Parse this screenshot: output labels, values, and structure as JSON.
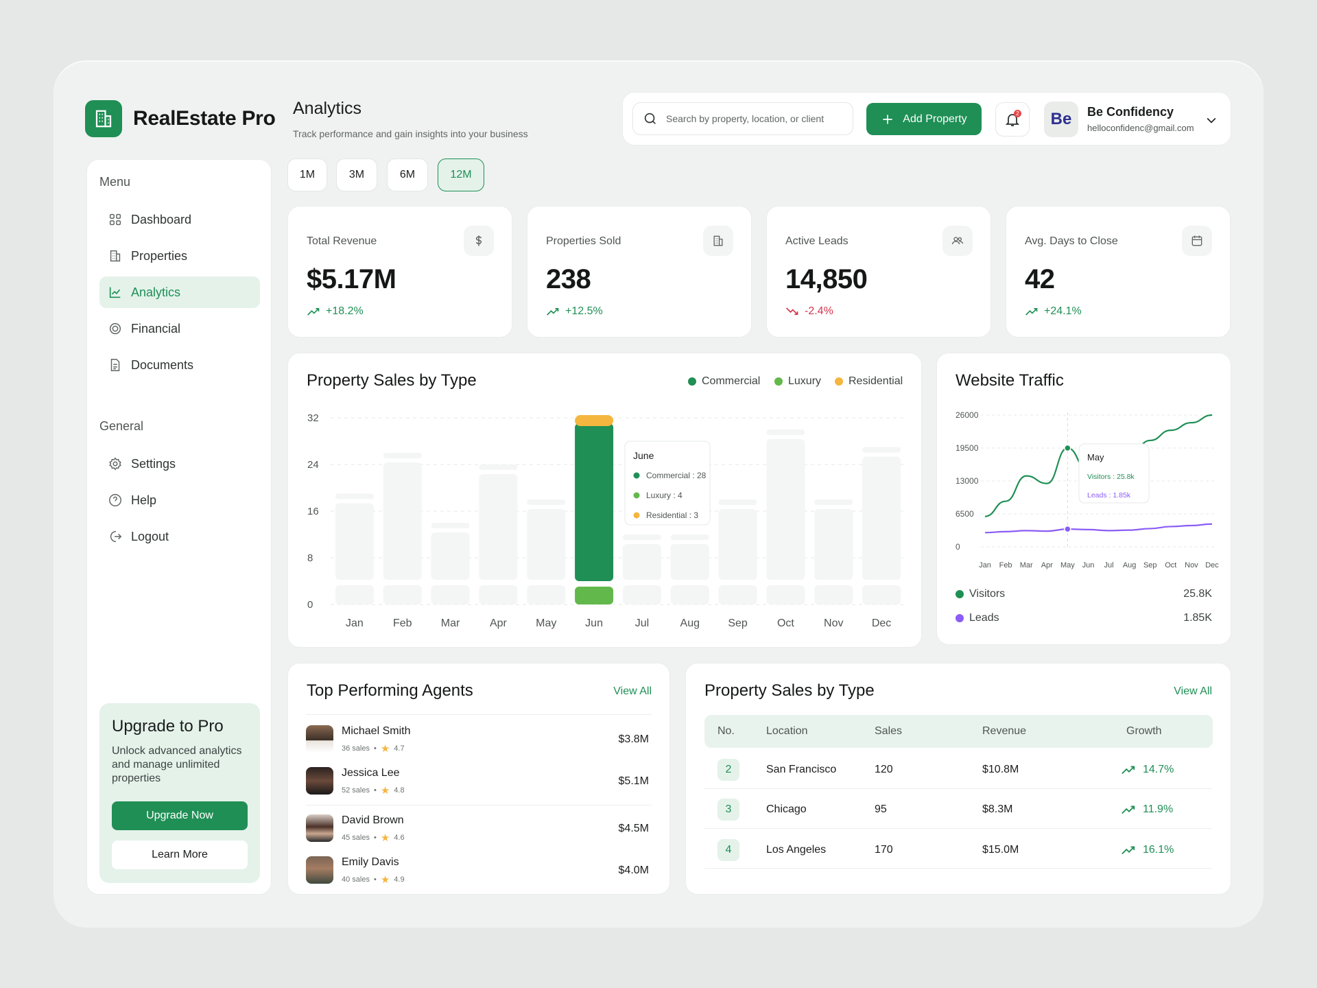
{
  "brand": {
    "name": "RealEstate Pro"
  },
  "header": {
    "title": "Analytics",
    "subtitle": "Track performance and gain insights into your business"
  },
  "topbar": {
    "search_placeholder": "Search by property, location, or client",
    "add_label": "Add Property",
    "notification_count": "2",
    "avatar_initials": "Be",
    "user_name": "Be Confidency",
    "user_email": "helloconfidenc@gmail.com"
  },
  "sidebar": {
    "menu_label": "Menu",
    "general_label": "General",
    "menu_items": [
      {
        "label": "Dashboard",
        "icon": "grid-icon"
      },
      {
        "label": "Properties",
        "icon": "building-icon"
      },
      {
        "label": "Analytics",
        "icon": "chart-icon",
        "active": true
      },
      {
        "label": "Financial",
        "icon": "coin-icon"
      },
      {
        "label": "Documents",
        "icon": "document-icon"
      }
    ],
    "general_items": [
      {
        "label": "Settings",
        "icon": "gear-icon"
      },
      {
        "label": "Help",
        "icon": "help-icon"
      },
      {
        "label": "Logout",
        "icon": "logout-icon"
      }
    ],
    "upgrade": {
      "title": "Upgrade to Pro",
      "text": "Unlock advanced analytics and manage unlimited properties",
      "primary": "Upgrade Now",
      "secondary": "Learn More"
    }
  },
  "ranges": [
    {
      "label": "1M"
    },
    {
      "label": "3M"
    },
    {
      "label": "6M"
    },
    {
      "label": "12M",
      "active": true
    }
  ],
  "stats": [
    {
      "label": "Total Revenue",
      "value": "$5.17M",
      "delta": "+18.2%",
      "dir": "up",
      "icon": "dollar-icon"
    },
    {
      "label": "Properties Sold",
      "value": "238",
      "delta": "+12.5%",
      "dir": "up",
      "icon": "building-icon"
    },
    {
      "label": "Active Leads",
      "value": "14,850",
      "delta": "-2.4%",
      "dir": "down",
      "icon": "users-icon"
    },
    {
      "label": "Avg. Days to Close",
      "value": "42",
      "delta": "+24.1%",
      "dir": "up",
      "icon": "calendar-icon"
    }
  ],
  "colors": {
    "accent": "#1f8f55",
    "commercial": "#1f8f55",
    "luxury": "#62b84b",
    "residential": "#f4b63f",
    "visitors": "#1f8f55",
    "leads": "#8b5cf6",
    "down": "#d6334a"
  },
  "chart_data": [
    {
      "type": "bar",
      "title": "Property Sales by Type",
      "categories": [
        "Jan",
        "Feb",
        "Mar",
        "Apr",
        "May",
        "Jun",
        "Jul",
        "Aug",
        "Sep",
        "Oct",
        "Nov",
        "Dec"
      ],
      "series": [
        {
          "name": "Commercial",
          "values": [
            null,
            null,
            null,
            null,
            null,
            28,
            null,
            null,
            null,
            null,
            null,
            null
          ]
        },
        {
          "name": "Luxury",
          "values": [
            null,
            null,
            null,
            null,
            null,
            4,
            null,
            null,
            null,
            null,
            null,
            null
          ]
        },
        {
          "name": "Residential",
          "values": [
            null,
            null,
            null,
            null,
            null,
            3,
            null,
            null,
            null,
            null,
            null,
            null
          ]
        }
      ],
      "inactive_totals": [
        19,
        26,
        14,
        24,
        18,
        32,
        12,
        12,
        18,
        30,
        18,
        27
      ],
      "y_ticks": [
        0,
        8,
        16,
        24,
        32
      ],
      "ylim": [
        0,
        32
      ],
      "tooltip": {
        "title": "June",
        "lines": [
          "Commercial : 28",
          "Luxury : 4",
          "Residential : 3"
        ]
      },
      "legend_placement": "top-right"
    },
    {
      "type": "line",
      "title": "Website Traffic",
      "x": [
        "Jan",
        "Feb",
        "Mar",
        "Apr",
        "May",
        "Jun",
        "Jul",
        "Aug",
        "Sep",
        "Oct",
        "Nov",
        "Dec"
      ],
      "series": [
        {
          "name": "Visitors",
          "values": [
            6000,
            9000,
            14000,
            12500,
            19500,
            15000,
            16500,
            18000,
            21000,
            23000,
            24500,
            26000
          ]
        },
        {
          "name": "Leads",
          "values": [
            2800,
            3000,
            3200,
            3100,
            3500,
            3400,
            3200,
            3300,
            3600,
            4000,
            4200,
            4500
          ]
        }
      ],
      "y_ticks": [
        "26000",
        "19500",
        "13000",
        "6500",
        "0"
      ],
      "ylim": [
        0,
        26000
      ],
      "tooltip": {
        "title": "May",
        "lines": [
          "Visitors : 25.8k",
          "Leads : 1.85k"
        ]
      },
      "summary": [
        {
          "label": "Visitors",
          "value": "25.8K"
        },
        {
          "label": "Leads",
          "value": "1.85K"
        }
      ]
    }
  ],
  "agents": {
    "title": "Top Performing Agents",
    "view_all": "View All",
    "rows": [
      {
        "name": "Michael Smith",
        "sales": "36 sales",
        "rating": "4.7",
        "amount": "$3.8M"
      },
      {
        "name": "Jessica Lee",
        "sales": "52 sales",
        "rating": "4.8",
        "amount": "$5.1M"
      },
      {
        "name": "David Brown",
        "sales": "45 sales",
        "rating": "4.6",
        "amount": "$4.5M"
      },
      {
        "name": "Emily Davis",
        "sales": "40 sales",
        "rating": "4.9",
        "amount": "$4.0M"
      }
    ]
  },
  "sales_table": {
    "title": "Property Sales by Type",
    "view_all": "View All",
    "headers": [
      "No.",
      "Location",
      "Sales",
      "Revenue",
      "Growth"
    ],
    "rows": [
      {
        "no": "2",
        "location": "San Francisco",
        "sales": "120",
        "revenue": "$10.8M",
        "growth": "14.7%"
      },
      {
        "no": "3",
        "location": "Chicago",
        "sales": "95",
        "revenue": "$8.3M",
        "growth": "11.9%"
      },
      {
        "no": "4",
        "location": "Los Angeles",
        "sales": "170",
        "revenue": "$15.0M",
        "growth": "16.1%"
      }
    ]
  }
}
